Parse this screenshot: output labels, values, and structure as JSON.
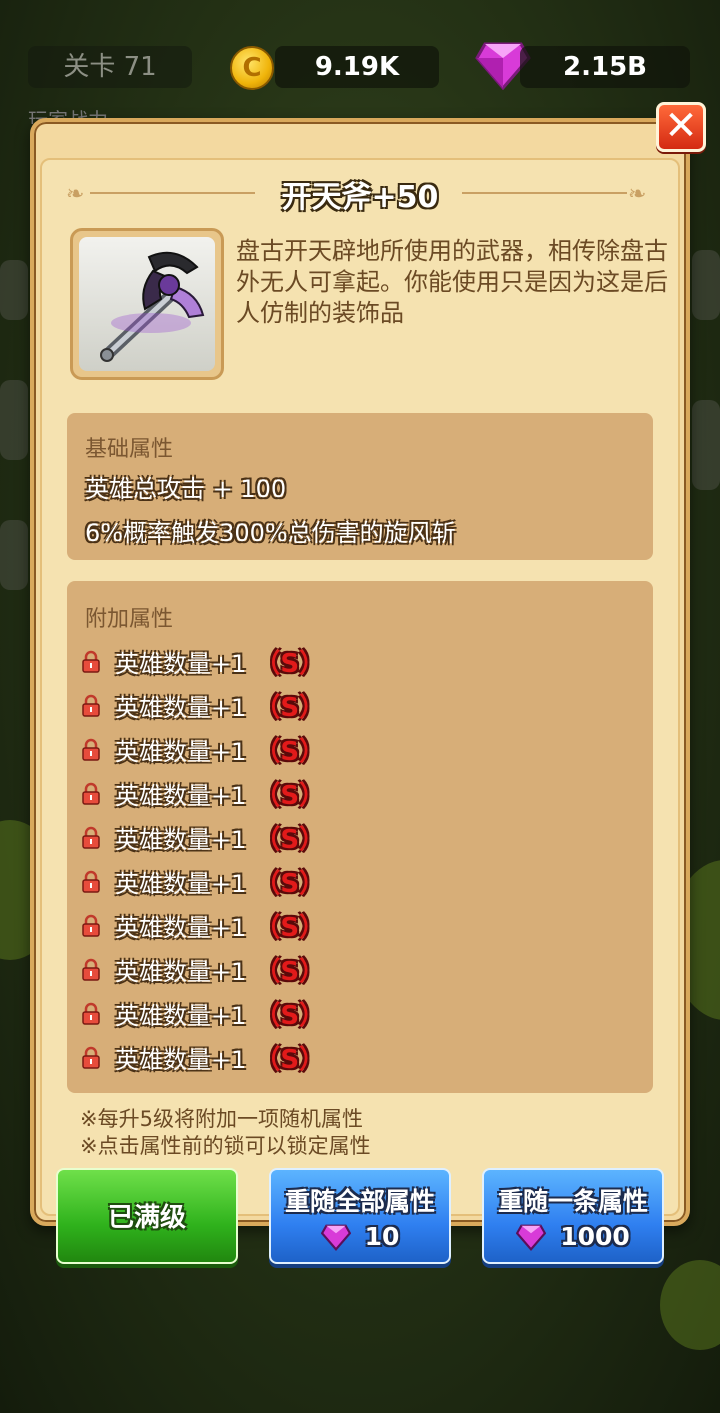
{
  "topbar": {
    "stage": "关卡 71",
    "coins": "9.19K",
    "gems": "2.15B",
    "power_label": "玩家战力"
  },
  "dialog": {
    "title": "开天斧+50",
    "description": "盘古开天辟地所使用的武器，相传除盘古外无人可拿起。你能使用只是因为这是后人仿制的装饰品",
    "base_title": "基础属性",
    "base_attrs": [
      "英雄总攻击 + 100",
      "6%概率触发300%总伤害的旋风斩"
    ],
    "extra_title": "附加属性",
    "extra_attrs": [
      {
        "text": "英雄数量+1",
        "rank": "（S）"
      },
      {
        "text": "英雄数量+1",
        "rank": "（S）"
      },
      {
        "text": "英雄数量+1",
        "rank": "（S）"
      },
      {
        "text": "英雄数量+1",
        "rank": "（S）"
      },
      {
        "text": "英雄数量+1",
        "rank": "（S）"
      },
      {
        "text": "英雄数量+1",
        "rank": "（S）"
      },
      {
        "text": "英雄数量+1",
        "rank": "（S）"
      },
      {
        "text": "英雄数量+1",
        "rank": "（S）"
      },
      {
        "text": "英雄数量+1",
        "rank": "（S）"
      },
      {
        "text": "英雄数量+1",
        "rank": "（S）"
      }
    ],
    "notes": [
      "※每升5级将附加一项随机属性",
      "※点击属性前的锁可以锁定属性"
    ],
    "buttons": {
      "max_level": "已满级",
      "reroll_all": "重随全部属性",
      "reroll_all_cost": "10",
      "reroll_one": "重随一条属性",
      "reroll_one_cost": "1000"
    }
  },
  "colors": {
    "panel": "#f3d9a0",
    "attr_box": "#d7ae78",
    "rank_red": "#e21a1a",
    "btn_green": "#2fb21c",
    "btn_blue": "#2f7ff0"
  },
  "icons": [
    "coin-icon",
    "gem-icon",
    "close-icon",
    "lock-icon",
    "axe-icon"
  ]
}
